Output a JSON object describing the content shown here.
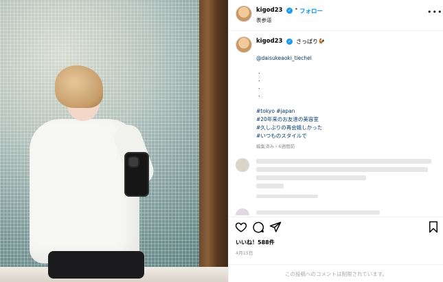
{
  "post": {
    "username": "kigod23",
    "follow_label": "フォロー",
    "separator": "•",
    "location": "表参道",
    "more_label": "•••",
    "caption": {
      "text": "さっぱり🐓",
      "mention": "@daisukeaoki_tiechel",
      "dots": ".\n.\n.\n.",
      "hashtags": [
        "#tokyo #japan",
        "#20年来のお友達の美容室",
        "#久しぶりの再会嬉しかった",
        "#いつものスタイルで"
      ],
      "meta": "編集済み・6週間前"
    },
    "likes": "いいね！588件",
    "date": "4月15日",
    "comments_disabled": "この投稿へのコメントは制限されています。"
  },
  "icons": {
    "like": "heart-icon",
    "comment": "comment-icon",
    "share": "share-icon",
    "save": "bookmark-icon",
    "verified": "verified-badge-icon",
    "more": "more-options-icon"
  },
  "colors": {
    "follow": "#0095f6",
    "hashtag": "#00376b",
    "verified": "#1d9bf0",
    "muted": "#8e8e8e"
  }
}
